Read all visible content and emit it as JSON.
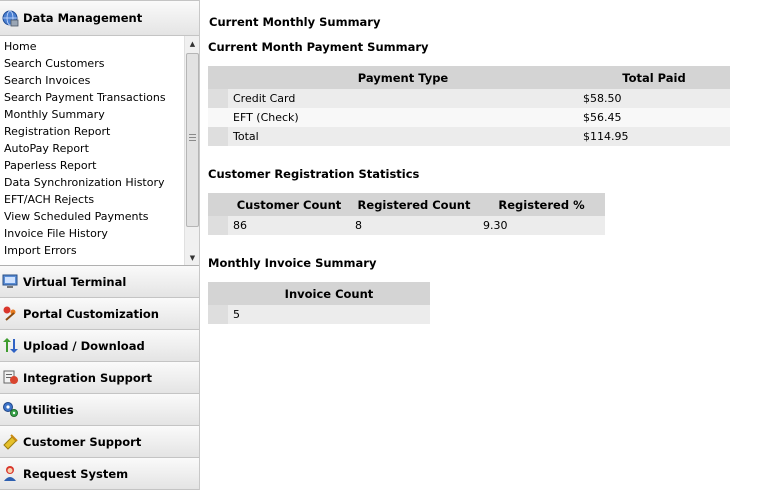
{
  "sidebar": {
    "top_section": {
      "label": "Data Management",
      "icon": "globe-disk-icon"
    },
    "items": [
      "Home",
      "Search Customers",
      "Search Invoices",
      "Search Payment Transactions",
      "Monthly Summary",
      "Registration Report",
      "AutoPay Report",
      "Paperless Report",
      "Data Synchronization History",
      "EFT/ACH Rejects",
      "View Scheduled Payments",
      "Invoice File History",
      "Import Errors"
    ],
    "sections": [
      {
        "label": "Virtual Terminal",
        "icon": "computer-icon"
      },
      {
        "label": "Portal Customization",
        "icon": "brush-icon"
      },
      {
        "label": "Upload / Download",
        "icon": "up-down-arrows-icon"
      },
      {
        "label": "Integration Support",
        "icon": "integration-icon"
      },
      {
        "label": "Utilities",
        "icon": "gears-icon"
      },
      {
        "label": "Customer Support",
        "icon": "support-icon"
      },
      {
        "label": "Request System",
        "icon": "person-icon"
      }
    ]
  },
  "main": {
    "page_title": "Current Monthly Summary",
    "payment_summary": {
      "title": "Current Month Payment Summary",
      "headers": [
        "Payment Type",
        "Total Paid"
      ],
      "rows": [
        [
          "Credit Card",
          "$58.50"
        ],
        [
          "EFT (Check)",
          "$56.45"
        ],
        [
          "Total",
          "$114.95"
        ]
      ]
    },
    "registration_stats": {
      "title": "Customer Registration Statistics",
      "headers": [
        "Customer Count",
        "Registered Count",
        "Registered %"
      ],
      "rows": [
        [
          "86",
          "8",
          "9.30"
        ]
      ]
    },
    "invoice_summary": {
      "title": "Monthly Invoice Summary",
      "headers": [
        "Invoice Count"
      ],
      "rows": [
        [
          "5"
        ]
      ]
    }
  }
}
